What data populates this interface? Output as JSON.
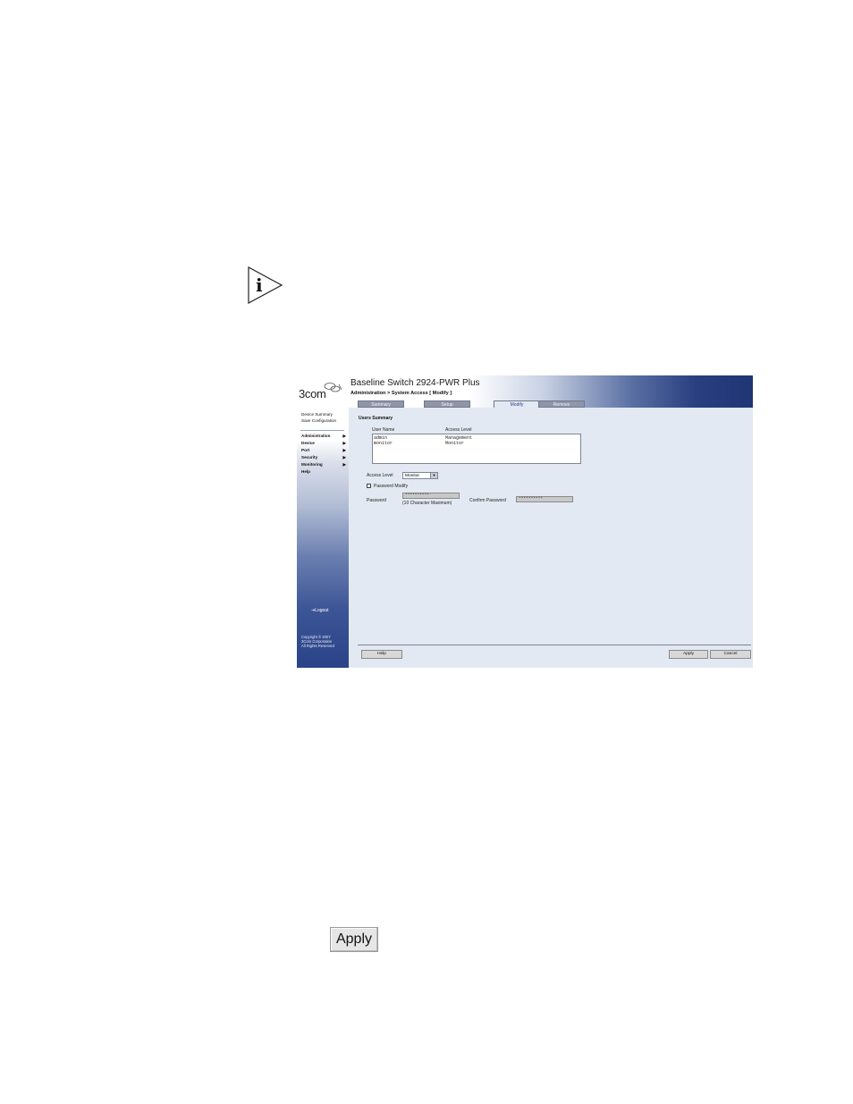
{
  "app": {
    "product_title": "Baseline Switch 2924-PWR Plus",
    "breadcrumb": "Administration > System Access [ Modify ]",
    "logo_text": "3com"
  },
  "tabs": [
    {
      "label": "Summary",
      "active": false
    },
    {
      "label": "Setup",
      "active": false
    },
    {
      "label": "Modify",
      "active": true
    },
    {
      "label": "Remove",
      "active": false
    }
  ],
  "sidebar": {
    "top_links": [
      "Device Summary",
      "Save Configuration"
    ],
    "nav": [
      "Administration",
      "Device",
      "Port",
      "Security",
      "Monitoring",
      "Help"
    ],
    "logout": "Logout",
    "copyright": [
      "Copyright © 2007",
      "3Com Corporation",
      "All Rights Reserved"
    ]
  },
  "users_summary": {
    "heading": "Users Summary",
    "col_user": "User Name",
    "col_level": "Access Level",
    "rows": [
      {
        "user": "admin",
        "level": "Management"
      },
      {
        "user": "monitor",
        "level": "Monitor"
      }
    ]
  },
  "form": {
    "access_level_label": "Access Level",
    "access_level_value": "Monitor",
    "password_modify_label": "Password Modify",
    "password_label": "Password",
    "password_value": "**********",
    "password_hint": "(10 Character Maximum)",
    "confirm_label": "Confirm Password",
    "confirm_value": "**********"
  },
  "buttons": {
    "help": "Help",
    "apply": "Apply",
    "cancel": "Cancel"
  },
  "apply_button_large": "Apply",
  "colors": {
    "banner_dark": "#1f3574",
    "content_bg": "#e3e9f2",
    "active_tab_text": "#2a3f86"
  }
}
